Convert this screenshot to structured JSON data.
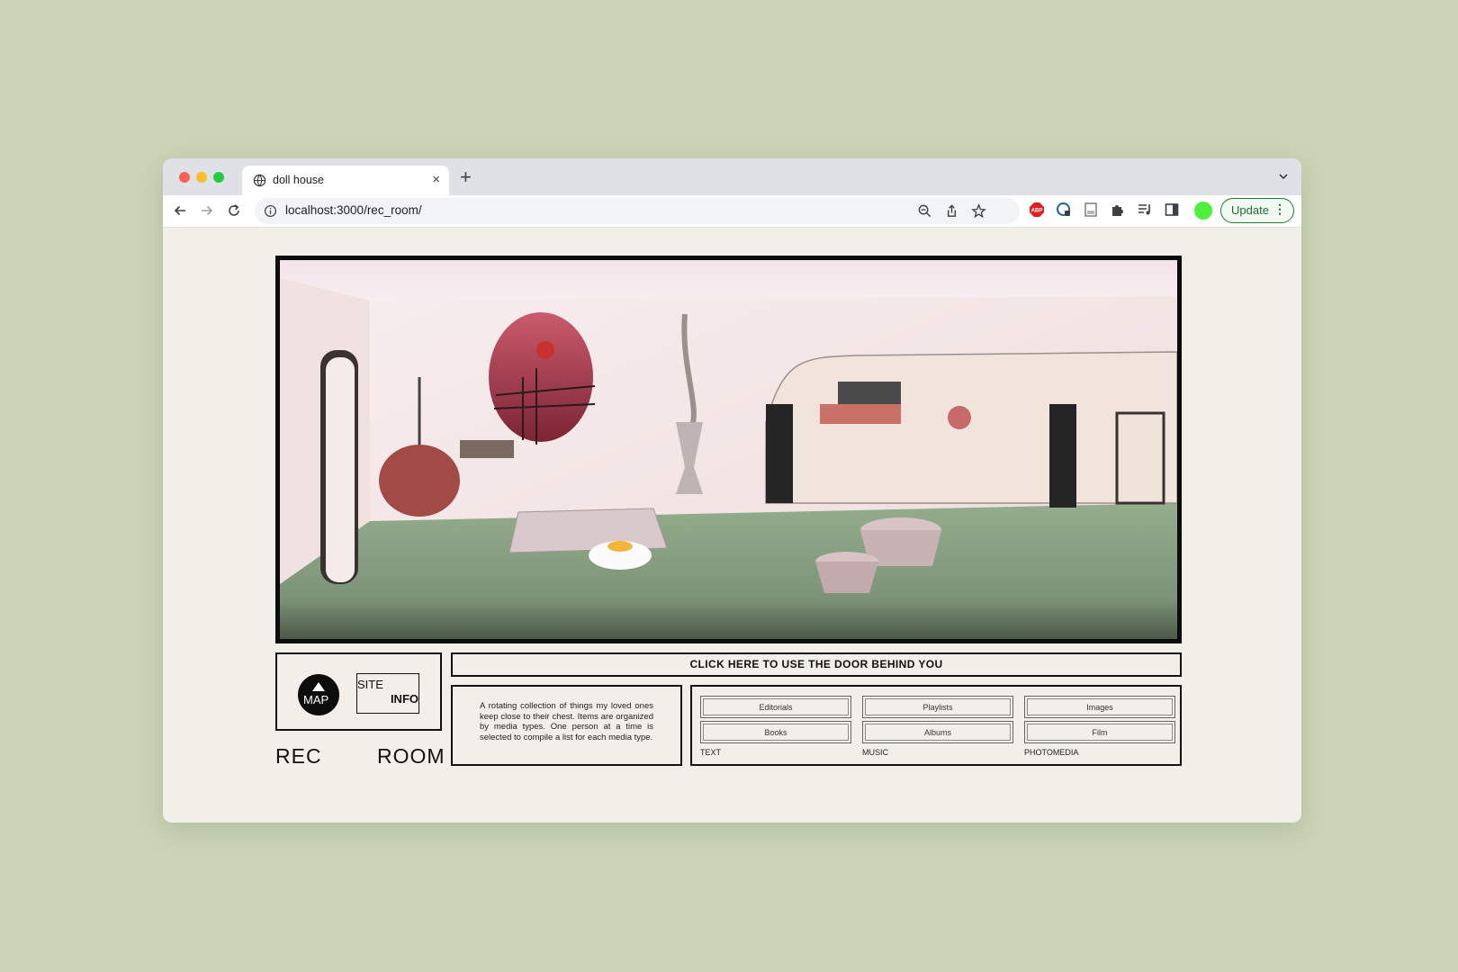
{
  "browser": {
    "tab_title": "doll house",
    "url": "localhost:3000/rec_room/",
    "update_label": "Update",
    "menu_dots": "⋮",
    "new_tab_glyph": "+",
    "close_tab_glyph": "×"
  },
  "icons": {
    "back": "arrow-left-icon",
    "forward": "arrow-right-icon",
    "reload": "reload-icon",
    "site_info": "info-icon",
    "zoom": "zoom-icon",
    "share": "share-icon",
    "bookmark": "star-icon",
    "extensions": [
      "adblock-icon",
      "password-manager-icon",
      "reader-icon",
      "puzzle-extensions-icon",
      "media-queue-icon",
      "side-panel-icon"
    ],
    "profile_color": "#4ef03b"
  },
  "page": {
    "map_label": "MAP",
    "site_label": "SITE",
    "info_label": "INFO",
    "room_title_left": "REC",
    "room_title_right": "ROOM",
    "door_cta": "CLICK HERE TO USE THE DOOR BEHIND YOU",
    "description": "A rotating collection of things my loved ones keep close to their chest. Items are organized by media types. One person at a time is selected to compile a list for each media type.",
    "media_groups": [
      {
        "category": "TEXT",
        "items": [
          "Editorials",
          "Books"
        ]
      },
      {
        "category": "MUSIC",
        "items": [
          "Playlists",
          "Albums"
        ]
      },
      {
        "category": "PHOTOMEDIA",
        "items": [
          "Images",
          "Film"
        ]
      }
    ]
  }
}
